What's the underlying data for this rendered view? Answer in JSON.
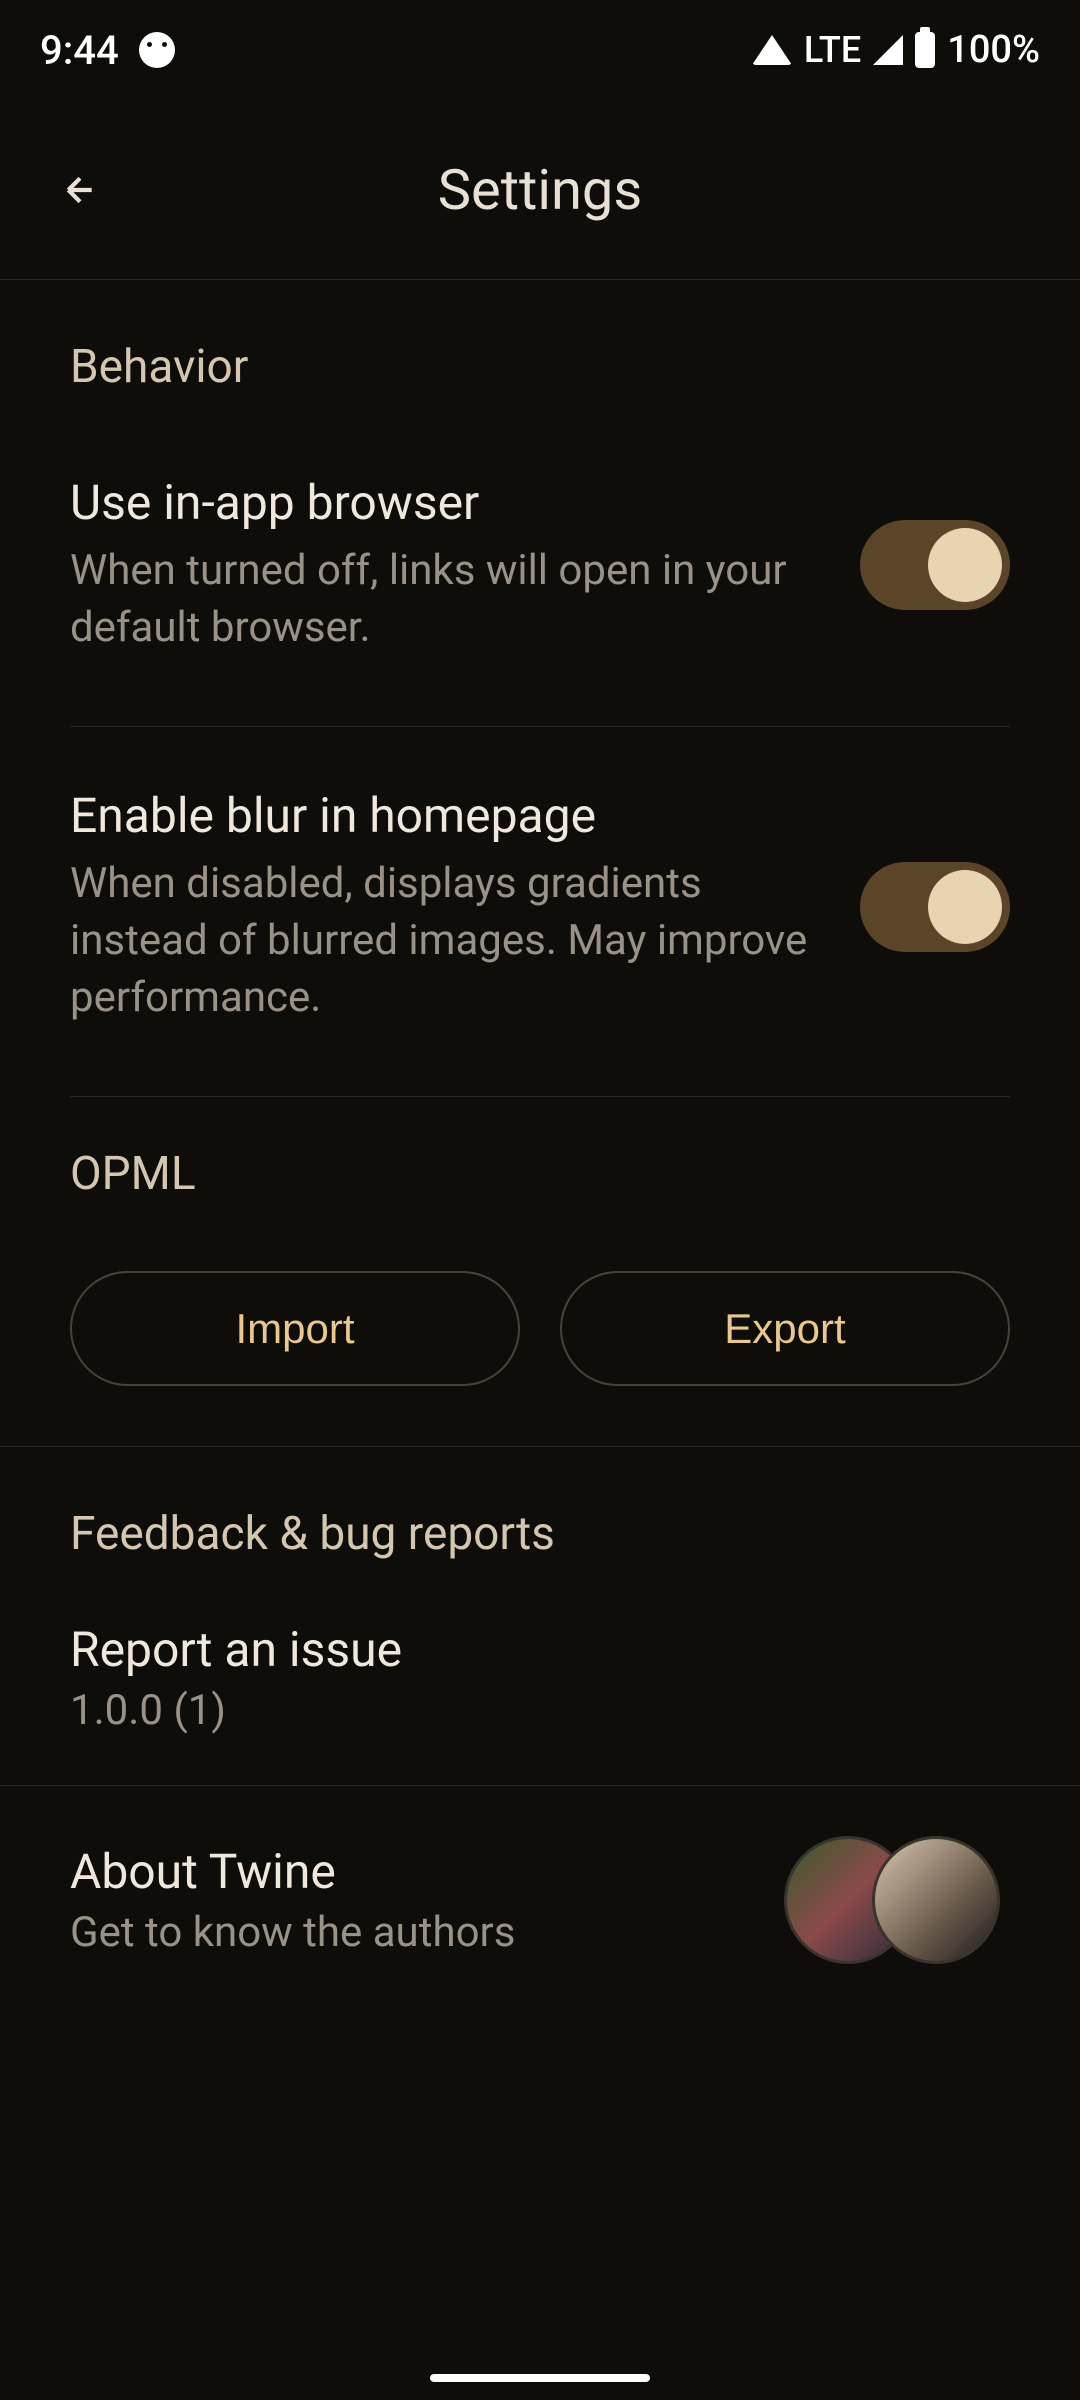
{
  "statusBar": {
    "time": "9:44",
    "lte": "LTE",
    "battery": "100%"
  },
  "header": {
    "title": "Settings"
  },
  "sections": {
    "behavior": {
      "header": "Behavior",
      "inAppBrowser": {
        "title": "Use in-app browser",
        "desc": "When turned off, links will open in your default browser."
      },
      "blurHomepage": {
        "title": "Enable blur in homepage",
        "desc": "When disabled, displays gradients instead of blurred images. May improve performance."
      }
    },
    "opml": {
      "header": "OPML",
      "importLabel": "Import",
      "exportLabel": "Export"
    },
    "feedback": {
      "header": "Feedback & bug reports",
      "reportTitle": "Report an issue",
      "version": "1.0.0 (1)"
    },
    "about": {
      "title": "About Twine",
      "subtitle": "Get to know the authors"
    }
  }
}
